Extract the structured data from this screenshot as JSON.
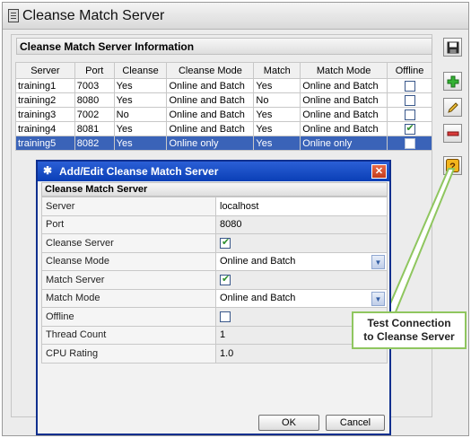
{
  "app": {
    "title": "Cleanse Match Server"
  },
  "info": {
    "title": "Cleanse Match Server Information"
  },
  "table": {
    "columns": [
      "Server",
      "Port",
      "Cleanse",
      "Cleanse Mode",
      "Match",
      "Match Mode",
      "Offline"
    ],
    "rows": [
      {
        "server": "training1",
        "port": "7003",
        "cleanse": "Yes",
        "cleanse_mode": "Online and Batch",
        "match": "Yes",
        "match_mode": "Online and Batch",
        "offline": false
      },
      {
        "server": "training2",
        "port": "8080",
        "cleanse": "Yes",
        "cleanse_mode": "Online and Batch",
        "match": "No",
        "match_mode": "Online and Batch",
        "offline": false
      },
      {
        "server": "training3",
        "port": "7002",
        "cleanse": "No",
        "cleanse_mode": "Online and Batch",
        "match": "Yes",
        "match_mode": "Online and Batch",
        "offline": false
      },
      {
        "server": "training4",
        "port": "8081",
        "cleanse": "Yes",
        "cleanse_mode": "Online and Batch",
        "match": "Yes",
        "match_mode": "Online and Batch",
        "offline": true
      },
      {
        "server": "training5",
        "port": "8082",
        "cleanse": "Yes",
        "cleanse_mode": "Online only",
        "match": "Yes",
        "match_mode": "Online only",
        "offline": false,
        "selected": true
      }
    ]
  },
  "side_buttons": [
    "save-icon",
    "add-icon",
    "edit-icon",
    "remove-icon",
    "help-icon"
  ],
  "dialog": {
    "title": "Add/Edit Cleanse Match Server",
    "section": "Cleanse Match Server",
    "fields": {
      "server_label": "Server",
      "server_value": "localhost",
      "port_label": "Port",
      "port_value": "8080",
      "cleanse_server_label": "Cleanse Server",
      "cleanse_server_checked": true,
      "cleanse_mode_label": "Cleanse Mode",
      "cleanse_mode_value": "Online and Batch",
      "match_server_label": "Match Server",
      "match_server_checked": true,
      "match_mode_label": "Match Mode",
      "match_mode_value": "Online and Batch",
      "offline_label": "Offline",
      "offline_checked": false,
      "thread_count_label": "Thread Count",
      "thread_count_value": "1",
      "cpu_rating_label": "CPU Rating",
      "cpu_rating_value": "1.0"
    },
    "ok_label": "OK",
    "cancel_label": "Cancel"
  },
  "callout": {
    "line1": "Test Connection",
    "line2": "to Cleanse Server"
  },
  "colors": {
    "selection": "#3a63b8",
    "dialog_title": "#0a3fb6",
    "callout_border": "#8fc65f"
  }
}
